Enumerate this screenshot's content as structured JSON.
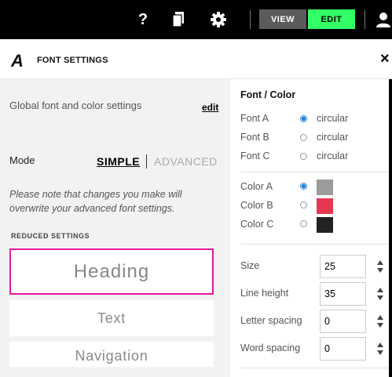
{
  "topbar": {
    "help_symbol": "?",
    "icons": [
      "help-icon",
      "pages-icon",
      "gear-icon",
      "user-icon"
    ],
    "view_label": "VIEW",
    "edit_label": "EDIT",
    "colors": {
      "bar": "#000000",
      "view_bg": "#5b5b5b",
      "edit_bg": "#33ff66"
    }
  },
  "panel": {
    "logo_letter": "A",
    "title": "FONT SETTINGS",
    "close_symbol": "×"
  },
  "left": {
    "global_text": "Global font and color settings",
    "edit_link": "edit",
    "mode_label": "Mode",
    "mode_simple": "SIMPLE",
    "mode_advanced": "ADVANCED",
    "note": "Please note that changes you make will overwrite your advanced font settings.",
    "reduced_label": "REDUCED SETTINGS",
    "presets": [
      "Heading",
      "Text",
      "Navigation"
    ],
    "selected_preset_color": "#e6199a"
  },
  "right": {
    "title": "Font / Color",
    "fonts": [
      {
        "label": "Font A",
        "value": "circular",
        "selected": true
      },
      {
        "label": "Font B",
        "value": "circular",
        "selected": false
      },
      {
        "label": "Font C",
        "value": "circular",
        "selected": false
      }
    ],
    "colors": [
      {
        "label": "Color A",
        "swatch": "#9b9b9b",
        "selected": true
      },
      {
        "label": "Color B",
        "swatch": "#e8384f",
        "selected": false
      },
      {
        "label": "Color C",
        "swatch": "#222222",
        "selected": false
      }
    ],
    "metrics": [
      {
        "label": "Size",
        "value": "25"
      },
      {
        "label": "Line height",
        "value": "35"
      },
      {
        "label": "Letter spacing",
        "value": "0"
      },
      {
        "label": "Word spacing",
        "value": "0"
      }
    ]
  }
}
